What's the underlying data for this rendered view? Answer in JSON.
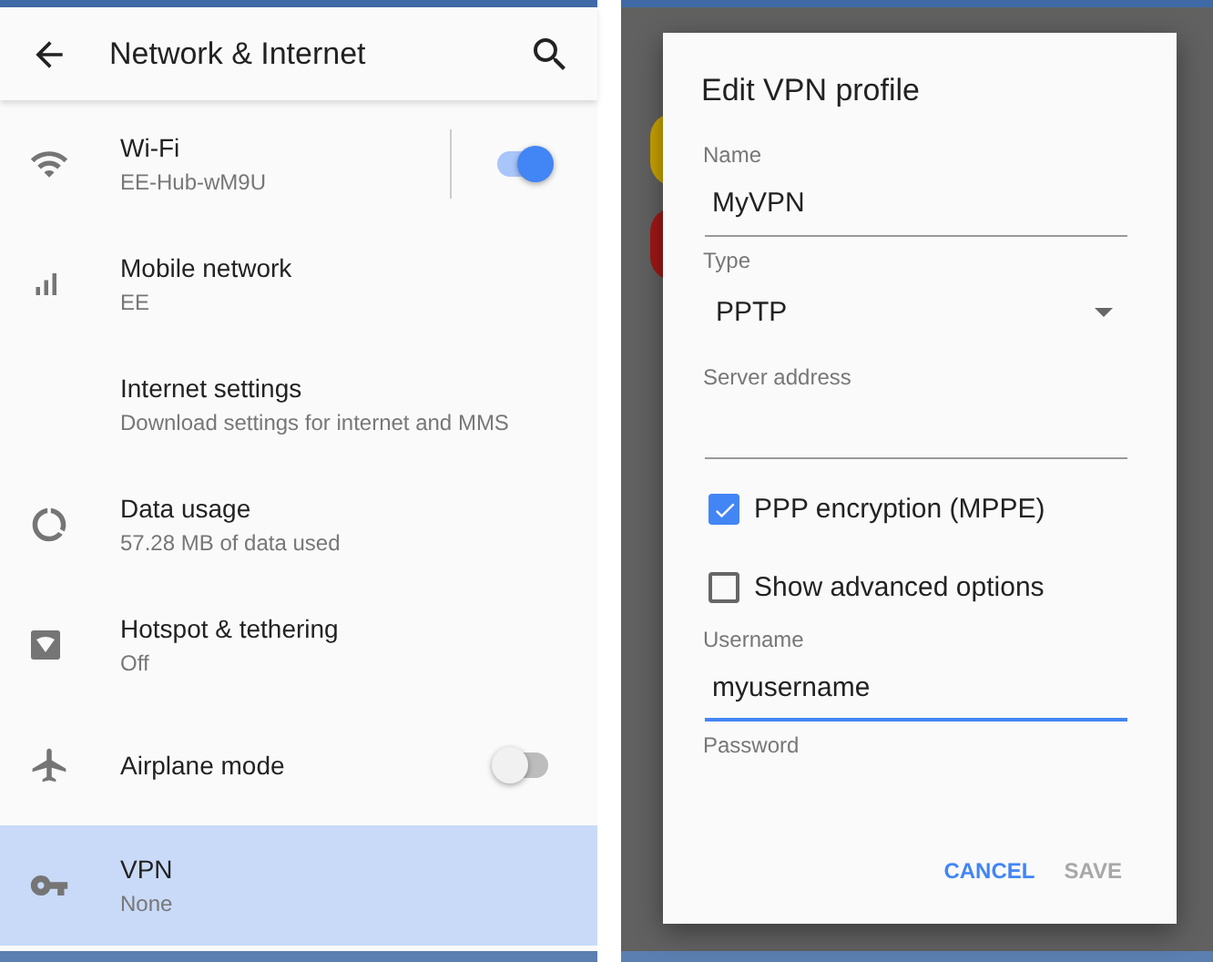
{
  "settings_screen": {
    "app_bar": {
      "title": "Network & Internet"
    },
    "items": [
      {
        "kind": "wifi",
        "title": "Wi-Fi",
        "subtitle": "EE-Hub-wM9U",
        "switch": {
          "on": true
        },
        "selected": false
      },
      {
        "kind": "mobile",
        "title": "Mobile network",
        "subtitle": "EE",
        "selected": false
      },
      {
        "kind": "internet",
        "title": "Internet settings",
        "subtitle": "Download settings for internet and MMS",
        "selected": false
      },
      {
        "kind": "data",
        "title": "Data usage",
        "subtitle": "57.28 MB of data used",
        "selected": false
      },
      {
        "kind": "hotspot",
        "title": "Hotspot & tethering",
        "subtitle": "Off",
        "selected": false
      },
      {
        "kind": "airplane",
        "title": "Airplane mode",
        "switch": {
          "on": false
        },
        "selected": false
      },
      {
        "kind": "vpn",
        "title": "VPN",
        "subtitle": "None",
        "selected": true
      }
    ]
  },
  "vpn_dialog": {
    "title": "Edit VPN profile",
    "fields": [
      {
        "kind": "text",
        "label": "Name",
        "value": "MyVPN",
        "focused": false
      },
      {
        "kind": "dropdown",
        "label": "Type",
        "value": "PPTP"
      },
      {
        "kind": "text",
        "label": "Server address",
        "focused": false
      },
      {
        "kind": "checkbox",
        "label": "PPP encryption (MPPE)",
        "checked": true
      },
      {
        "kind": "checkbox",
        "label": "Show advanced options",
        "checked": false
      },
      {
        "kind": "text",
        "label": "Username",
        "value": "myusername",
        "focused": true
      },
      {
        "kind": "password",
        "label": "Password"
      }
    ],
    "buttons": [
      {
        "label": "CANCEL",
        "disabled": false
      },
      {
        "label": "SAVE",
        "disabled": true
      }
    ]
  }
}
